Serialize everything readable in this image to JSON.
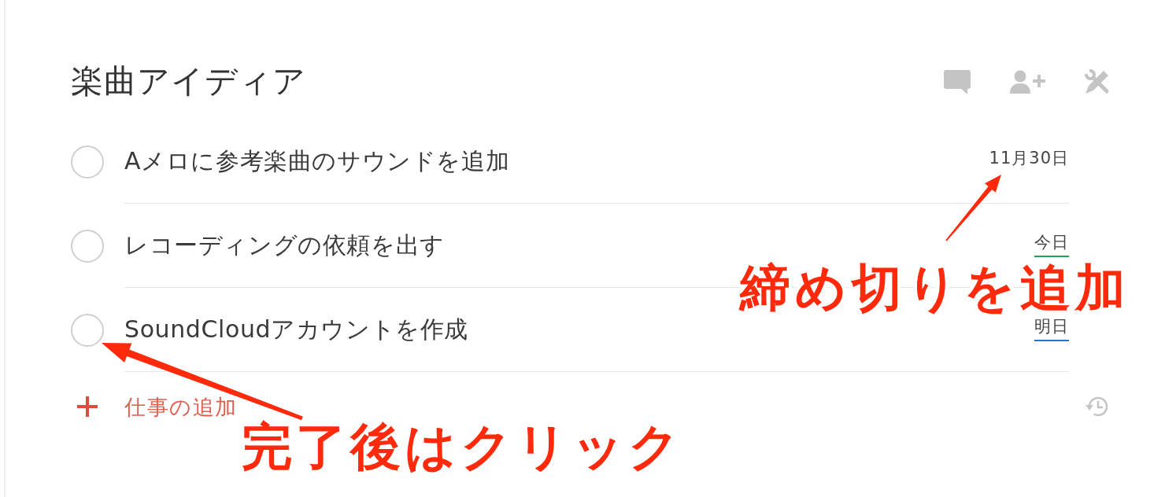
{
  "project": {
    "title": "楽曲アイディア"
  },
  "tasks": [
    {
      "title": "Aメロに参考楽曲のサウンドを追加",
      "checked": false,
      "due": "11月30日"
    },
    {
      "title": "レコーディングの依頼を出す",
      "checked": false,
      "due": "今日",
      "color": "#23a058"
    },
    {
      "title": "SoundCloudアカウントを作成",
      "checked": false,
      "due": "明日",
      "color": "#2e6fd3"
    }
  ],
  "add_task": {
    "label": "仕事の追加"
  },
  "annotations": [
    {
      "text": "締め切りを追加"
    },
    {
      "text": "完了後はクリック"
    }
  ]
}
